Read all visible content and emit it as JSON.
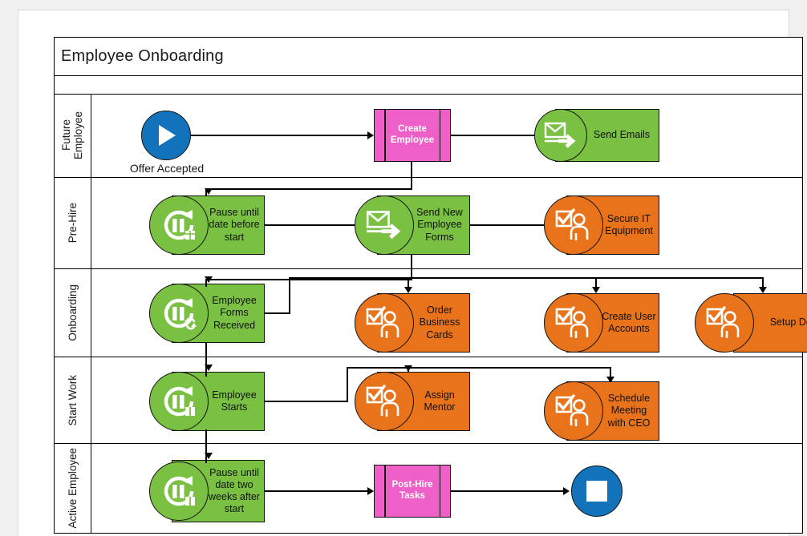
{
  "document": {
    "title": "Employee Onboarding"
  },
  "colors": {
    "green": "#7ac143",
    "orange": "#e8731b",
    "pink": "#ef5fc8",
    "blue": "#1273ba",
    "stroke": "#111111",
    "page_background": "#f0f0f0",
    "sheet_background": "#ffffff"
  },
  "lanes": [
    {
      "id": "future-employee",
      "label": "Future\nEmployee"
    },
    {
      "id": "pre-hire",
      "label": "Pre-Hire"
    },
    {
      "id": "onboarding",
      "label": "Onboarding"
    },
    {
      "id": "start-work",
      "label": "Start Work"
    },
    {
      "id": "active-employee",
      "label": "Active Employee"
    }
  ],
  "nodes": {
    "offer_accepted": {
      "label": "Offer Accepted",
      "type": "start-event",
      "icon": "play-icon"
    },
    "create_employee": {
      "label": "Create\nEmployee",
      "type": "subprocess"
    },
    "send_emails": {
      "label": "Send Emails",
      "type": "task",
      "icon": "send-email-icon"
    },
    "pause_before_start": {
      "label": "Pause until\ndate before\nstart",
      "type": "timer",
      "icon": "timer-pause-icon"
    },
    "send_new_employee_forms": {
      "label": "Send New\nEmployee\nForms",
      "type": "task",
      "icon": "send-email-icon"
    },
    "secure_it_equipment": {
      "label": "Secure IT\nEquipment",
      "type": "user-task",
      "icon": "user-task-icon"
    },
    "employee_forms_received": {
      "label": "Employee\nForms\nReceived",
      "type": "timer",
      "icon": "timer-receive-icon"
    },
    "order_business_cards": {
      "label": "Order\nBusiness\nCards",
      "type": "user-task",
      "icon": "user-task-icon"
    },
    "create_user_accounts": {
      "label": "Create User\nAccounts",
      "type": "user-task",
      "icon": "user-task-icon"
    },
    "setup_desk": {
      "label": "Setup Desk",
      "type": "user-task",
      "icon": "user-task-icon"
    },
    "employee_starts": {
      "label": "Employee\nStarts",
      "type": "timer",
      "icon": "timer-pause-icon"
    },
    "assign_mentor": {
      "label": "Assign\nMentor",
      "type": "user-task",
      "icon": "user-task-icon"
    },
    "schedule_meeting_ceo": {
      "label": "Schedule\nMeeting\nwith CEO",
      "type": "user-task",
      "icon": "user-task-icon"
    },
    "pause_two_weeks": {
      "label": "Pause until\ndate two\nweeks after\nstart",
      "type": "timer",
      "icon": "timer-pause-icon"
    },
    "post_hire_tasks": {
      "label": "Post-Hire\nTasks",
      "type": "subprocess"
    },
    "end_event": {
      "label": "",
      "type": "end-event",
      "icon": "stop-icon"
    }
  }
}
